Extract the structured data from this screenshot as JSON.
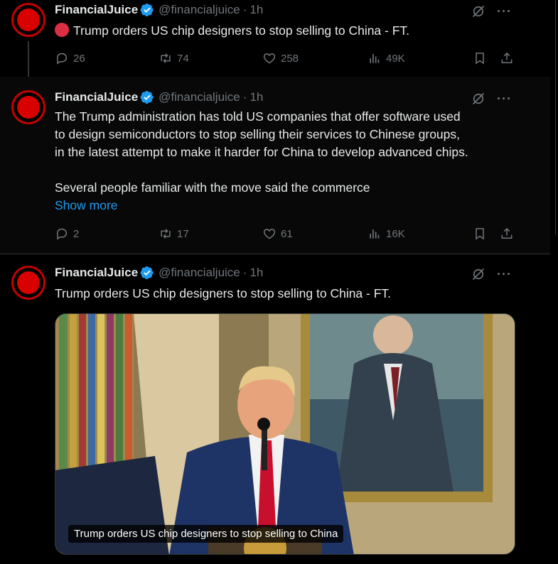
{
  "tweets": [
    {
      "author_name": "FinancialJuice",
      "handle": "@financialjuice",
      "separator": "·",
      "time": "1h",
      "text": "Trump orders US chip designers to stop selling to China - FT.",
      "has_red_circle": true,
      "actions": {
        "replies": "26",
        "reposts": "74",
        "likes": "258",
        "views": "49K"
      }
    },
    {
      "author_name": "FinancialJuice",
      "handle": "@financialjuice",
      "separator": "·",
      "time": "1h",
      "text_line1": "The Trump administration has told US companies that offer software used",
      "text_line2": "to design semiconductors to stop selling their services to Chinese groups,",
      "text_line3": "in the latest attempt to make it harder for China to develop advanced chips.",
      "text_line4": "Several people familiar with the move said the commerce",
      "show_more": "Show more",
      "actions": {
        "replies": "2",
        "reposts": "17",
        "likes": "61",
        "views": "16K"
      }
    },
    {
      "author_name": "FinancialJuice",
      "handle": "@financialjuice",
      "separator": "·",
      "time": "1h",
      "text": "Trump orders US chip designers to stop selling to China - FT.",
      "media_caption": "Trump orders US chip designers to stop selling to China"
    }
  ],
  "icons": {
    "verified": "verified-badge-icon",
    "grok": "grok-icon",
    "more": "more-icon",
    "reply": "reply-icon",
    "repost": "repost-icon",
    "like": "like-icon",
    "views": "views-icon",
    "bookmark": "bookmark-icon",
    "share": "share-icon"
  },
  "colors": {
    "background": "#000000",
    "accent": "#1d9bf0",
    "avatar_red": "#d90000",
    "muted": "#71767b"
  }
}
